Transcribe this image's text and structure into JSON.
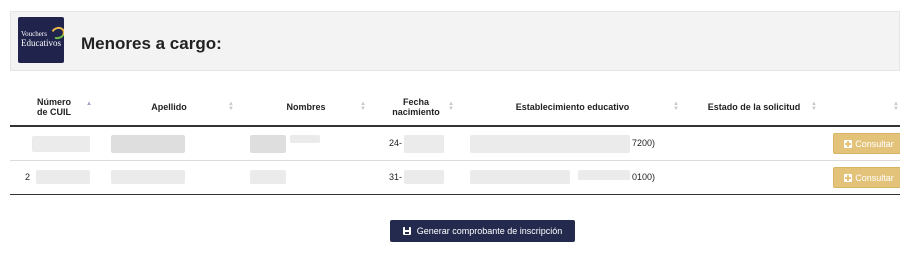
{
  "header": {
    "logo_line1": "Vouchers",
    "logo_line2": "Educativos",
    "title": "Menores a cargo:"
  },
  "table": {
    "columns": [
      {
        "line1": "Número",
        "line2": "de CUIL"
      },
      {
        "line1": "Apellido",
        "line2": ""
      },
      {
        "line1": "Nombres",
        "line2": ""
      },
      {
        "line1": "Fecha",
        "line2": "nacimiento"
      },
      {
        "line1": "Establecimiento educativo",
        "line2": ""
      },
      {
        "line1": "Estado de la solicitud",
        "line2": ""
      },
      {
        "line1": "",
        "line2": ""
      }
    ],
    "rows": [
      {
        "cuil": "",
        "fecha": "24-",
        "establecimiento": "7200)",
        "action": "Consultar"
      },
      {
        "cuil": "2",
        "fecha": "31-",
        "establecimiento": "0100)",
        "action": "Consultar"
      }
    ]
  },
  "footer": {
    "generar_label": "Generar comprobante de inscripción"
  },
  "colors": {
    "brand_navy": "#232a4e",
    "consultar_gold": "#e3c37a"
  }
}
